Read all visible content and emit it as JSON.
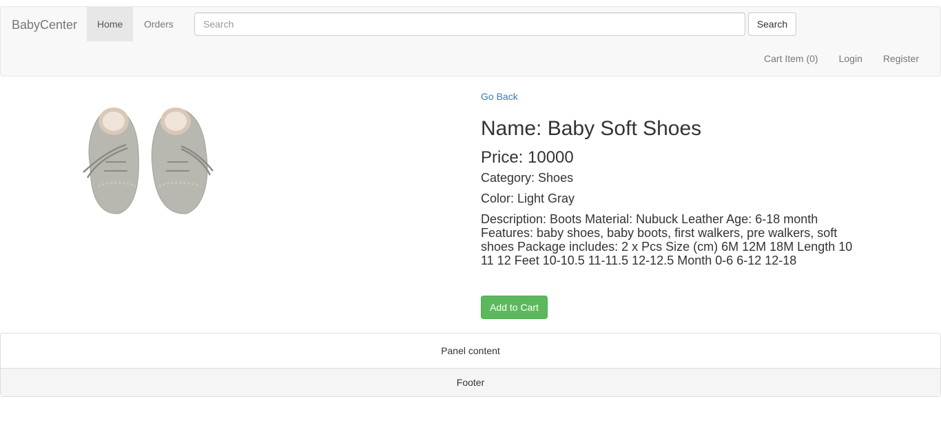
{
  "navbar": {
    "brand": "BabyCenter",
    "home": "Home",
    "orders": "Orders",
    "search_placeholder": "Search",
    "search_button": "Search",
    "cart": "Cart Item (0)",
    "login": "Login",
    "register": "Register"
  },
  "product": {
    "go_back": "Go Back",
    "name": "Name: Baby Soft Shoes",
    "price": "Price: 10000",
    "category": "Category: Shoes",
    "color": "Color: Light Gray",
    "description": "Description: Boots Material: Nubuck Leather Age: 6-18 month Features: baby shoes, baby boots, first walkers, pre walkers, soft shoes Package includes: 2 x Pcs Size (cm) 6M 12M 18M Length 10 11 12 Feet 10-10.5 11-11.5 12-12.5 Month 0-6 6-12 12-18",
    "add_to_cart": "Add to Cart",
    "image_icon": "baby-shoes-image"
  },
  "panel": {
    "content": "Panel content",
    "footer": "Footer"
  },
  "colors": {
    "link": "#337ab7",
    "success": "#5cb85c",
    "navbar_bg": "#f8f8f8",
    "shoe": "#b8b8b0"
  }
}
